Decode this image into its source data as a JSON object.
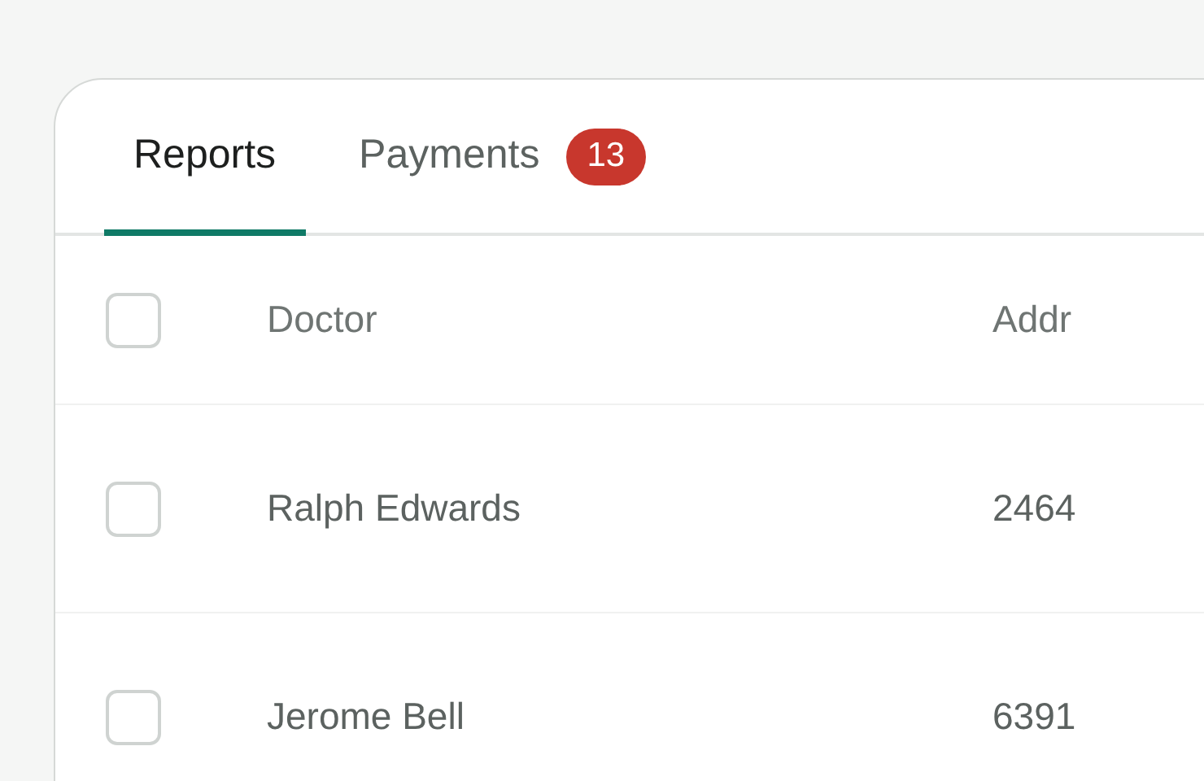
{
  "tabs": [
    {
      "label": "Reports",
      "selected": true
    },
    {
      "label": "Payments",
      "selected": false,
      "badge": "13"
    }
  ],
  "table": {
    "columns": [
      {
        "label": "Doctor"
      },
      {
        "label": "Addr"
      }
    ],
    "header_checked": false,
    "rows": [
      {
        "checked": false,
        "cells": [
          "Ralph Edwards",
          "2464"
        ]
      },
      {
        "checked": false,
        "cells": [
          "Jerome Bell",
          "6391"
        ]
      }
    ]
  }
}
